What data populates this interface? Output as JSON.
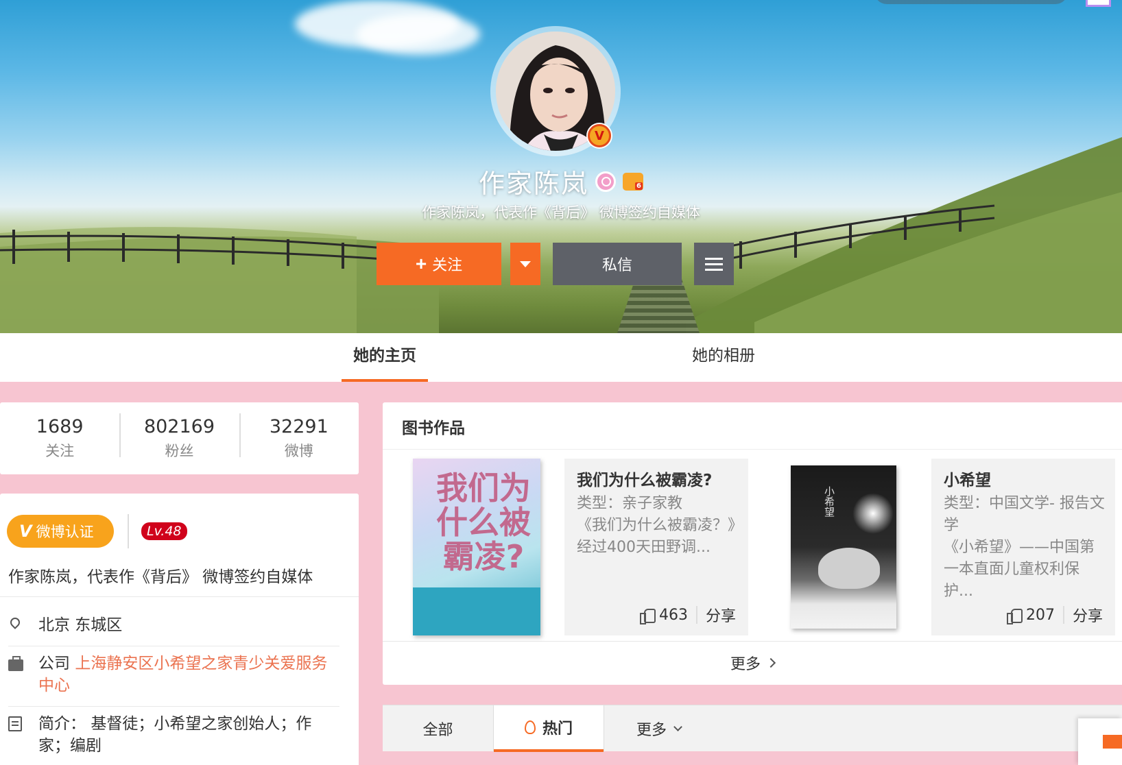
{
  "profile": {
    "name": "作家陈岚",
    "intro": "作家陈岚，代表作《背后》 微博签约自媒体",
    "follow_label": "关注",
    "message_label": "私信"
  },
  "nav": {
    "home_label": "她的主页",
    "album_label": "她的相册"
  },
  "stats": [
    {
      "value": "1689",
      "label": "关注"
    },
    {
      "value": "802169",
      "label": "粉丝"
    },
    {
      "value": "32291",
      "label": "微博"
    }
  ],
  "profile_card": {
    "verify_label": "微博认证",
    "level": "Lv.48",
    "intro": "作家陈岚，代表作《背后》 微博签约自媒体",
    "location": "北京 东城区",
    "company_prefix": "公司",
    "company": "上海静安区小希望之家青少关爱服务中心",
    "bio_prefix": "简介：",
    "bio": "基督徒；小希望之家创始人；作家；编剧"
  },
  "books": {
    "title": "图书作品",
    "items": [
      {
        "title": "我们为什么被霸凌?",
        "type": "类型：亲子家教",
        "desc": "《我们为什么被霸凌？》经过400天田野调...",
        "likes": "463",
        "share": "分享",
        "cover_text": "我们为什么被霸凌?"
      },
      {
        "title": "小希望",
        "type": "类型：中国文学- 报告文学",
        "desc": "《小希望》——中国第一本直面儿童权利保护...",
        "likes": "207",
        "share": "分享",
        "cover_text": "小希望"
      }
    ],
    "more_label": "更多"
  },
  "feed_tabs": {
    "all": "全部",
    "hot": "热门",
    "more": "更多"
  },
  "colors": {
    "accent": "#f66a24",
    "page_bg": "#f7c5d1",
    "button_gray": "#5e6168",
    "verify": "#f8a31c",
    "link": "#eb7350"
  },
  "icons": {
    "verified": "verified-v-icon",
    "gender": "female-icon",
    "vip": "vip-crown-icon",
    "menu": "hamburger-icon",
    "location": "location-pin-icon",
    "company": "briefcase-icon",
    "bio": "edit-note-icon",
    "like": "thumb-up-icon",
    "hot": "flame-icon"
  }
}
